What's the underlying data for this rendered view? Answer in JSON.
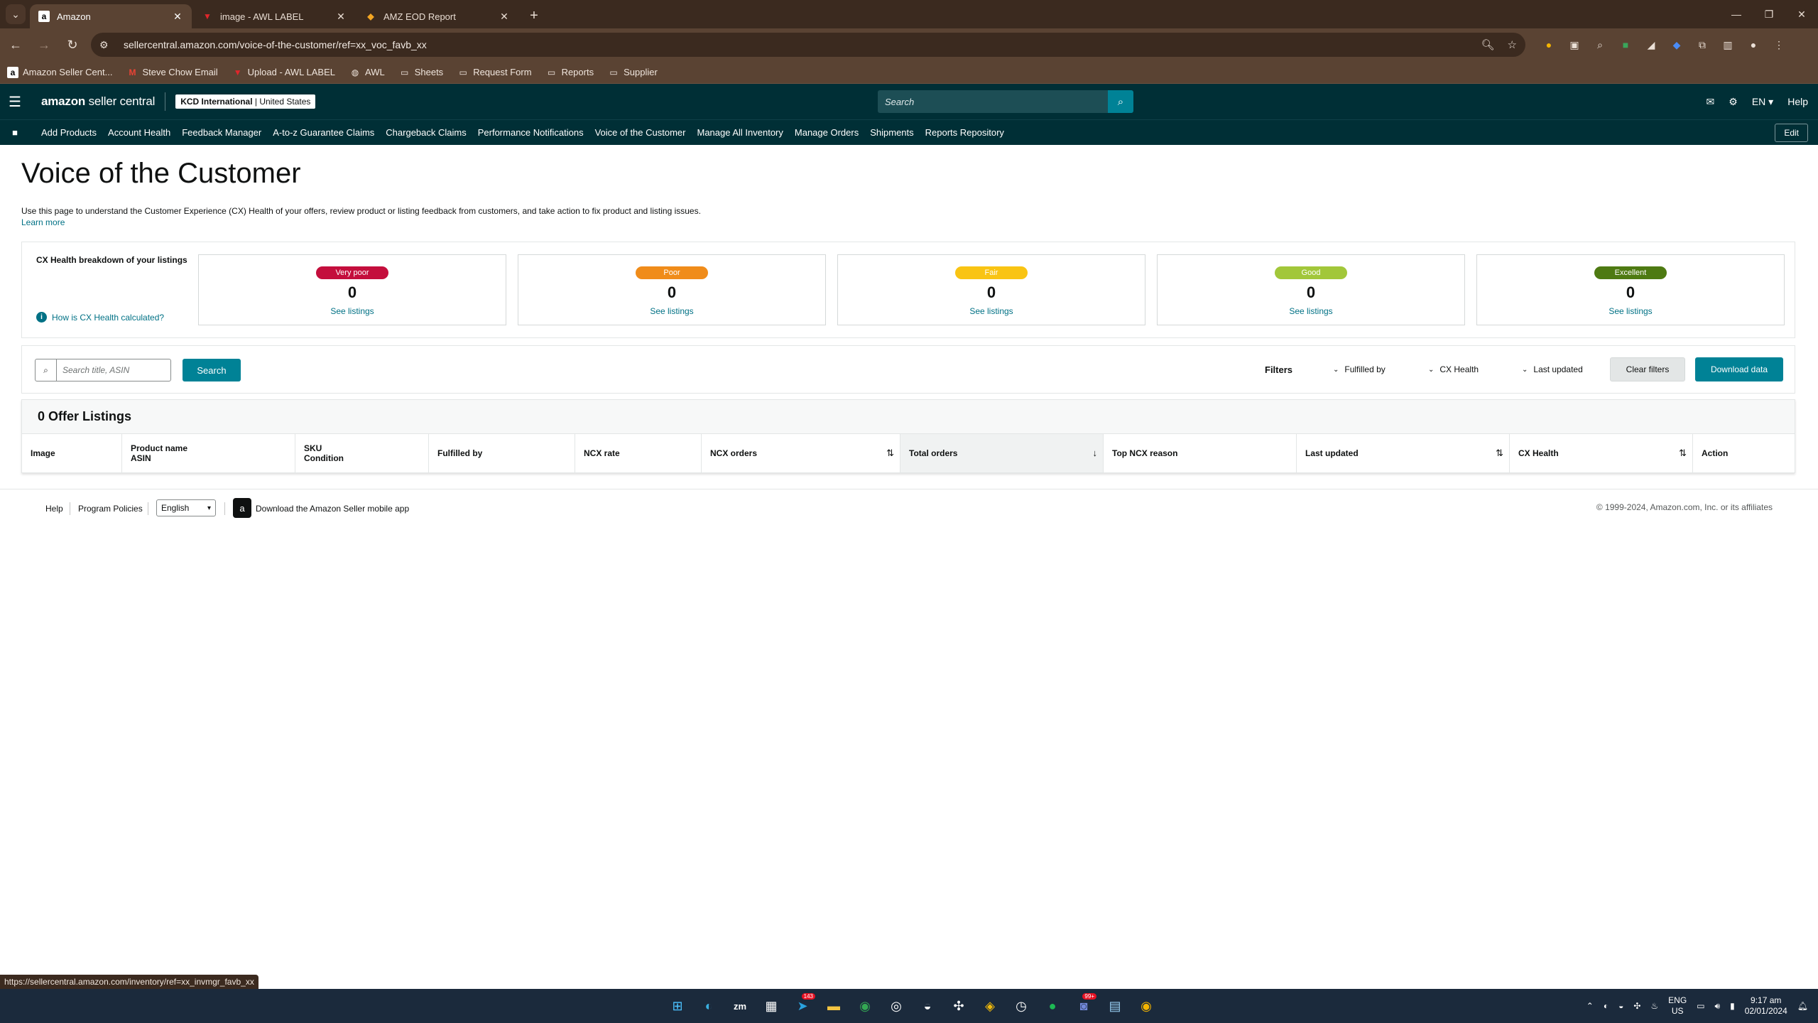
{
  "browser": {
    "tabs": [
      {
        "title": "Amazon",
        "icon": "amazon-icon",
        "active": true
      },
      {
        "title": "image - AWL LABEL",
        "icon": "awl-icon",
        "active": false
      },
      {
        "title": "AMZ EOD Report",
        "icon": "report-icon",
        "active": false
      }
    ],
    "url": "sellercentral.amazon.com/voice-of-the-customer/ref=xx_voc_favb_xx",
    "bookmarks": [
      {
        "label": "Amazon Seller Cent...",
        "icon": "amazon-icon"
      },
      {
        "label": "Steve Chow Email",
        "icon": "gmail-icon"
      },
      {
        "label": "Upload - AWL LABEL",
        "icon": "awl-icon"
      },
      {
        "label": "AWL",
        "icon": "globe-icon"
      },
      {
        "label": "Sheets",
        "icon": "folder-icon"
      },
      {
        "label": "Request Form",
        "icon": "folder-icon"
      },
      {
        "label": "Reports",
        "icon": "folder-icon"
      },
      {
        "label": "Supplier",
        "icon": "folder-icon"
      }
    ],
    "status_url": "https://sellercentral.amazon.com/inventory/ref=xx_invmgr_favb_xx"
  },
  "header": {
    "logo_a": "amazon",
    "logo_b": " seller central",
    "account_name": "KCD International",
    "account_region": "United States",
    "search_placeholder": "Search",
    "lang": "EN",
    "help": "Help"
  },
  "nav": {
    "items": [
      "Add Products",
      "Account Health",
      "Feedback Manager",
      "A-to-z Guarantee Claims",
      "Chargeback Claims",
      "Performance Notifications",
      "Voice of the Customer",
      "Manage All Inventory",
      "Manage Orders",
      "Shipments",
      "Reports Repository"
    ],
    "edit": "Edit"
  },
  "page": {
    "title": "Voice of the Customer",
    "description": "Use this page to understand the Customer Experience (CX) Health of your offers, review product or listing feedback from customers, and take action to fix product and listing issues.",
    "learn_more": "Learn more"
  },
  "cx_health": {
    "label": "CX Health breakdown of your listings",
    "help_link": "How is CX Health calculated?",
    "cards": [
      {
        "label": "Very poor",
        "count": "0",
        "link": "See listings",
        "color": "#c40e3c"
      },
      {
        "label": "Poor",
        "count": "0",
        "link": "See listings",
        "color": "#f08c1a"
      },
      {
        "label": "Fair",
        "count": "0",
        "link": "See listings",
        "color": "#f9c413"
      },
      {
        "label": "Good",
        "count": "0",
        "link": "See listings",
        "color": "#a2c73a"
      },
      {
        "label": "Excellent",
        "count": "0",
        "link": "See listings",
        "color": "#4e7a12"
      }
    ]
  },
  "search": {
    "placeholder": "Search title, ASIN",
    "button": "Search",
    "filters_label": "Filters",
    "filters": [
      "Fulfilled by",
      "CX Health",
      "Last updated"
    ],
    "clear": "Clear filters",
    "download": "Download data"
  },
  "listings": {
    "heading": "0 Offer Listings",
    "columns": [
      {
        "line1": "Image",
        "line2": ""
      },
      {
        "line1": "Product name",
        "line2": "ASIN"
      },
      {
        "line1": "SKU",
        "line2": "Condition"
      },
      {
        "line1": "Fulfilled by",
        "line2": ""
      },
      {
        "line1": "NCX rate",
        "line2": ""
      },
      {
        "line1": "NCX orders",
        "line2": ""
      },
      {
        "line1": "Total orders",
        "line2": ""
      },
      {
        "line1": "Top NCX reason",
        "line2": ""
      },
      {
        "line1": "Last updated",
        "line2": ""
      },
      {
        "line1": "CX Health",
        "line2": ""
      },
      {
        "line1": "Action",
        "line2": ""
      }
    ]
  },
  "footer": {
    "help": "Help",
    "policies": "Program Policies",
    "language": "English",
    "app_link": "Download the Amazon Seller mobile app",
    "copyright": "© 1999-2024, Amazon.com, Inc. or its affiliates"
  },
  "taskbar": {
    "lang_top": "ENG",
    "lang_bottom": "US",
    "time": "9:17 am",
    "date": "02/01/2024",
    "badge_a": "143",
    "badge_b": "99+"
  }
}
